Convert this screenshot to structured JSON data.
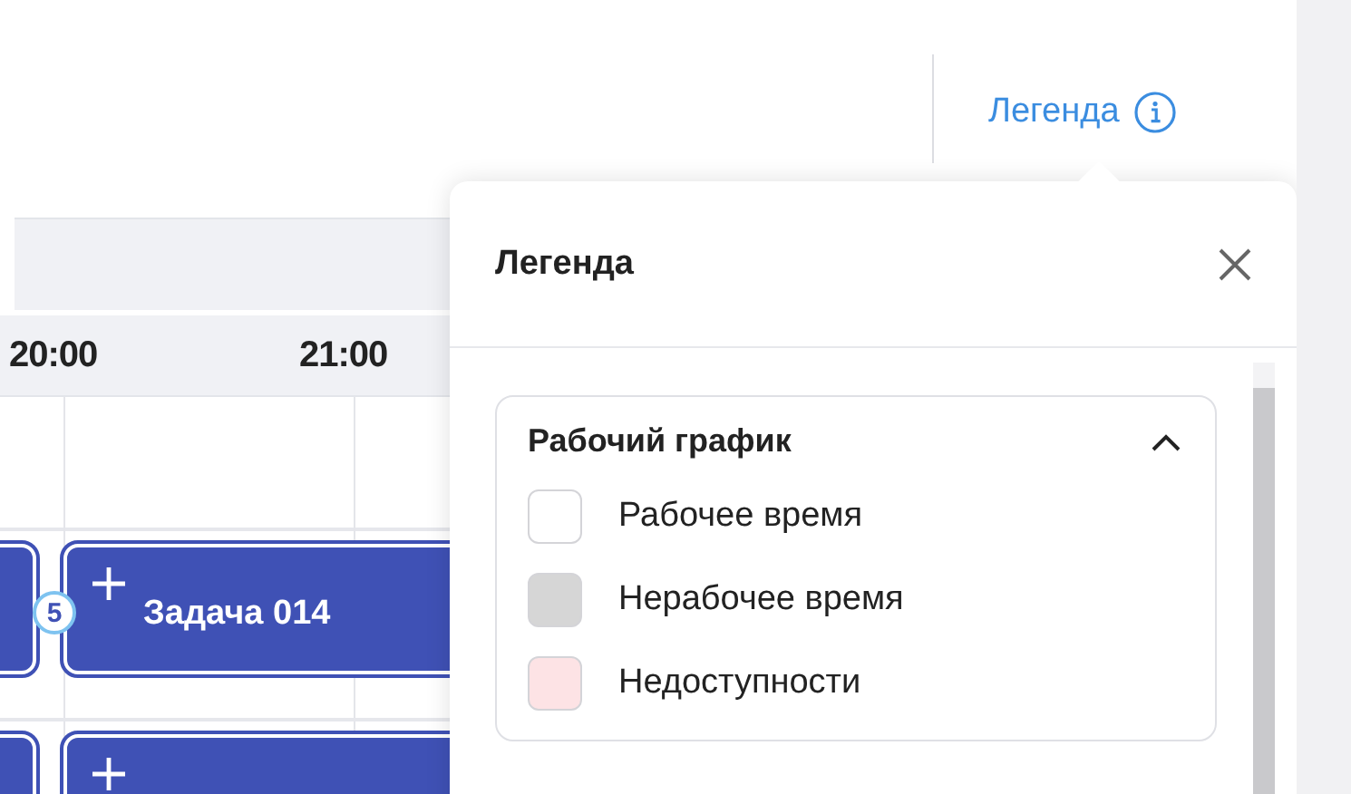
{
  "header": {
    "legend_link": "Легенда"
  },
  "calendar": {
    "time_labels": [
      "20:00",
      "21:00"
    ],
    "rows": [
      {
        "tasks": [
          {
            "kind": "task",
            "label": "Задача 014",
            "badge": "5"
          }
        ]
      },
      {
        "tasks": [
          {
            "kind": "task"
          }
        ]
      }
    ]
  },
  "legend": {
    "title": "Легенда",
    "sections": [
      {
        "title": "Рабочий график",
        "expanded": true,
        "items": [
          {
            "label": "Рабочее время",
            "color": "#ffffff"
          },
          {
            "label": "Нерабочее время",
            "color": "#d6d6d6"
          },
          {
            "label": "Недоступности",
            "color": "#fde3e5"
          }
        ]
      }
    ]
  }
}
